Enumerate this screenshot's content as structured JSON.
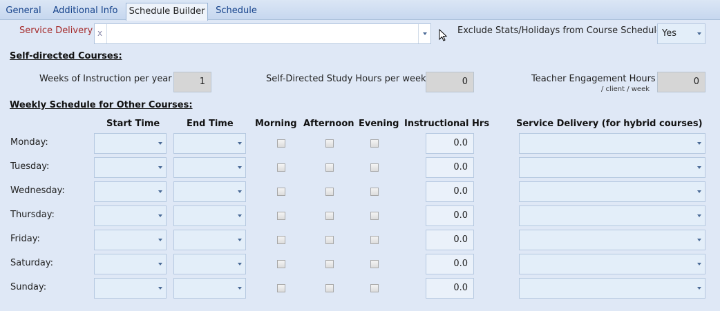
{
  "tabs": [
    "General",
    "Additional Info",
    "Schedule Builder",
    "Schedule"
  ],
  "active_tab": "Schedule Builder",
  "service_delivery": {
    "label": "Service Delivery",
    "value": "x"
  },
  "exclude": {
    "label": "Exclude Stats/Holidays from Course Schedule",
    "value": "Yes"
  },
  "self_directed": {
    "title": "Self-directed Courses:",
    "weeks_label": "Weeks of Instruction per year",
    "weeks_value": "1",
    "study_label": "Self-Directed Study Hours per week",
    "study_value": "0",
    "teacher_label": "Teacher Engagement Hours",
    "teacher_sub": "/ client / week",
    "teacher_value": "0"
  },
  "weekly": {
    "title": "Weekly Schedule for Other Courses:",
    "headers": {
      "start": "Start Time",
      "end": "End Time",
      "morning": "Morning",
      "afternoon": "Afternoon",
      "evening": "Evening",
      "hours": "Instructional Hrs",
      "delivery": "Service Delivery (for hybrid courses)"
    },
    "days": [
      {
        "name": "Monday:",
        "hours": "0.0"
      },
      {
        "name": "Tuesday:",
        "hours": "0.0"
      },
      {
        "name": "Wednesday:",
        "hours": "0.0"
      },
      {
        "name": "Thursday:",
        "hours": "0.0"
      },
      {
        "name": "Friday:",
        "hours": "0.0"
      },
      {
        "name": "Saturday:",
        "hours": "0.0"
      },
      {
        "name": "Sunday:",
        "hours": "0.0"
      }
    ]
  }
}
